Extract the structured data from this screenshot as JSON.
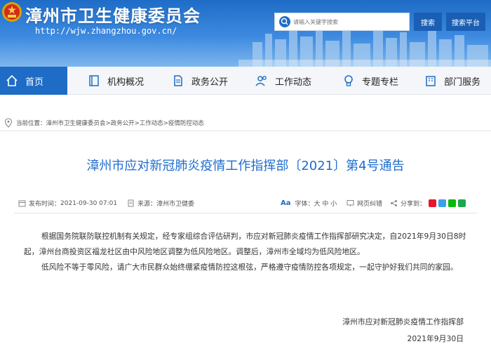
{
  "header": {
    "title": "漳州市卫生健康委员会",
    "url": "http://wjw.zhangzhou.gov.cn/",
    "search_placeholder": "请输入关键字搜索",
    "search_button": "搜索",
    "platform_button": "搜索平台"
  },
  "nav": {
    "items": [
      {
        "label": "首页",
        "icon": "home-icon",
        "active": true
      },
      {
        "label": "机构概况",
        "icon": "book-icon"
      },
      {
        "label": "政务公开",
        "icon": "document-icon"
      },
      {
        "label": "工作动态",
        "icon": "people-icon"
      },
      {
        "label": "专题专栏",
        "icon": "lightbulb-icon"
      },
      {
        "label": "部门服务",
        "icon": "building-icon"
      }
    ]
  },
  "breadcrumb": {
    "prefix": "当前位置：",
    "path": "漳州市卫生健康委员会>政务公开>工作动态>疫情防控动态"
  },
  "article": {
    "title": "漳州市应对新冠肺炎疫情工作指挥部〔2021〕第4号通告",
    "publish_label": "发布时间：",
    "publish_time": "2021-09-30 07:01",
    "source_label": "来源：",
    "source": "漳州市卫健委",
    "font_aa": "Aa",
    "font_size_label": "字体：",
    "font_sizes": "大 中 小",
    "correction": "网页纠错",
    "share_label": "分享到：",
    "paragraphs": [
      "根据国务院联防联控机制有关规定，经专家组综合评估研判，市应对新冠肺炎疫情工作指挥部研究决定，自2021年9月30日8时起，漳州台商投资区福龙社区由中风险地区调整为低风险地区。调整后，漳州市全域均为低风险地区。",
      "低风险不等于零风险，请广大市民群众始终绷紧疫情防控这根弦，严格遵守疫情防控各项规定，一起守护好我们共同的家园。"
    ],
    "signature_org": "漳州市应对新冠肺炎疫情工作指挥部",
    "signature_date": "2021年9月30日"
  },
  "colors": {
    "brand_blue": "#1e6cc6",
    "title_blue": "#1d6ccd",
    "button_blue": "#1a5fb4"
  }
}
